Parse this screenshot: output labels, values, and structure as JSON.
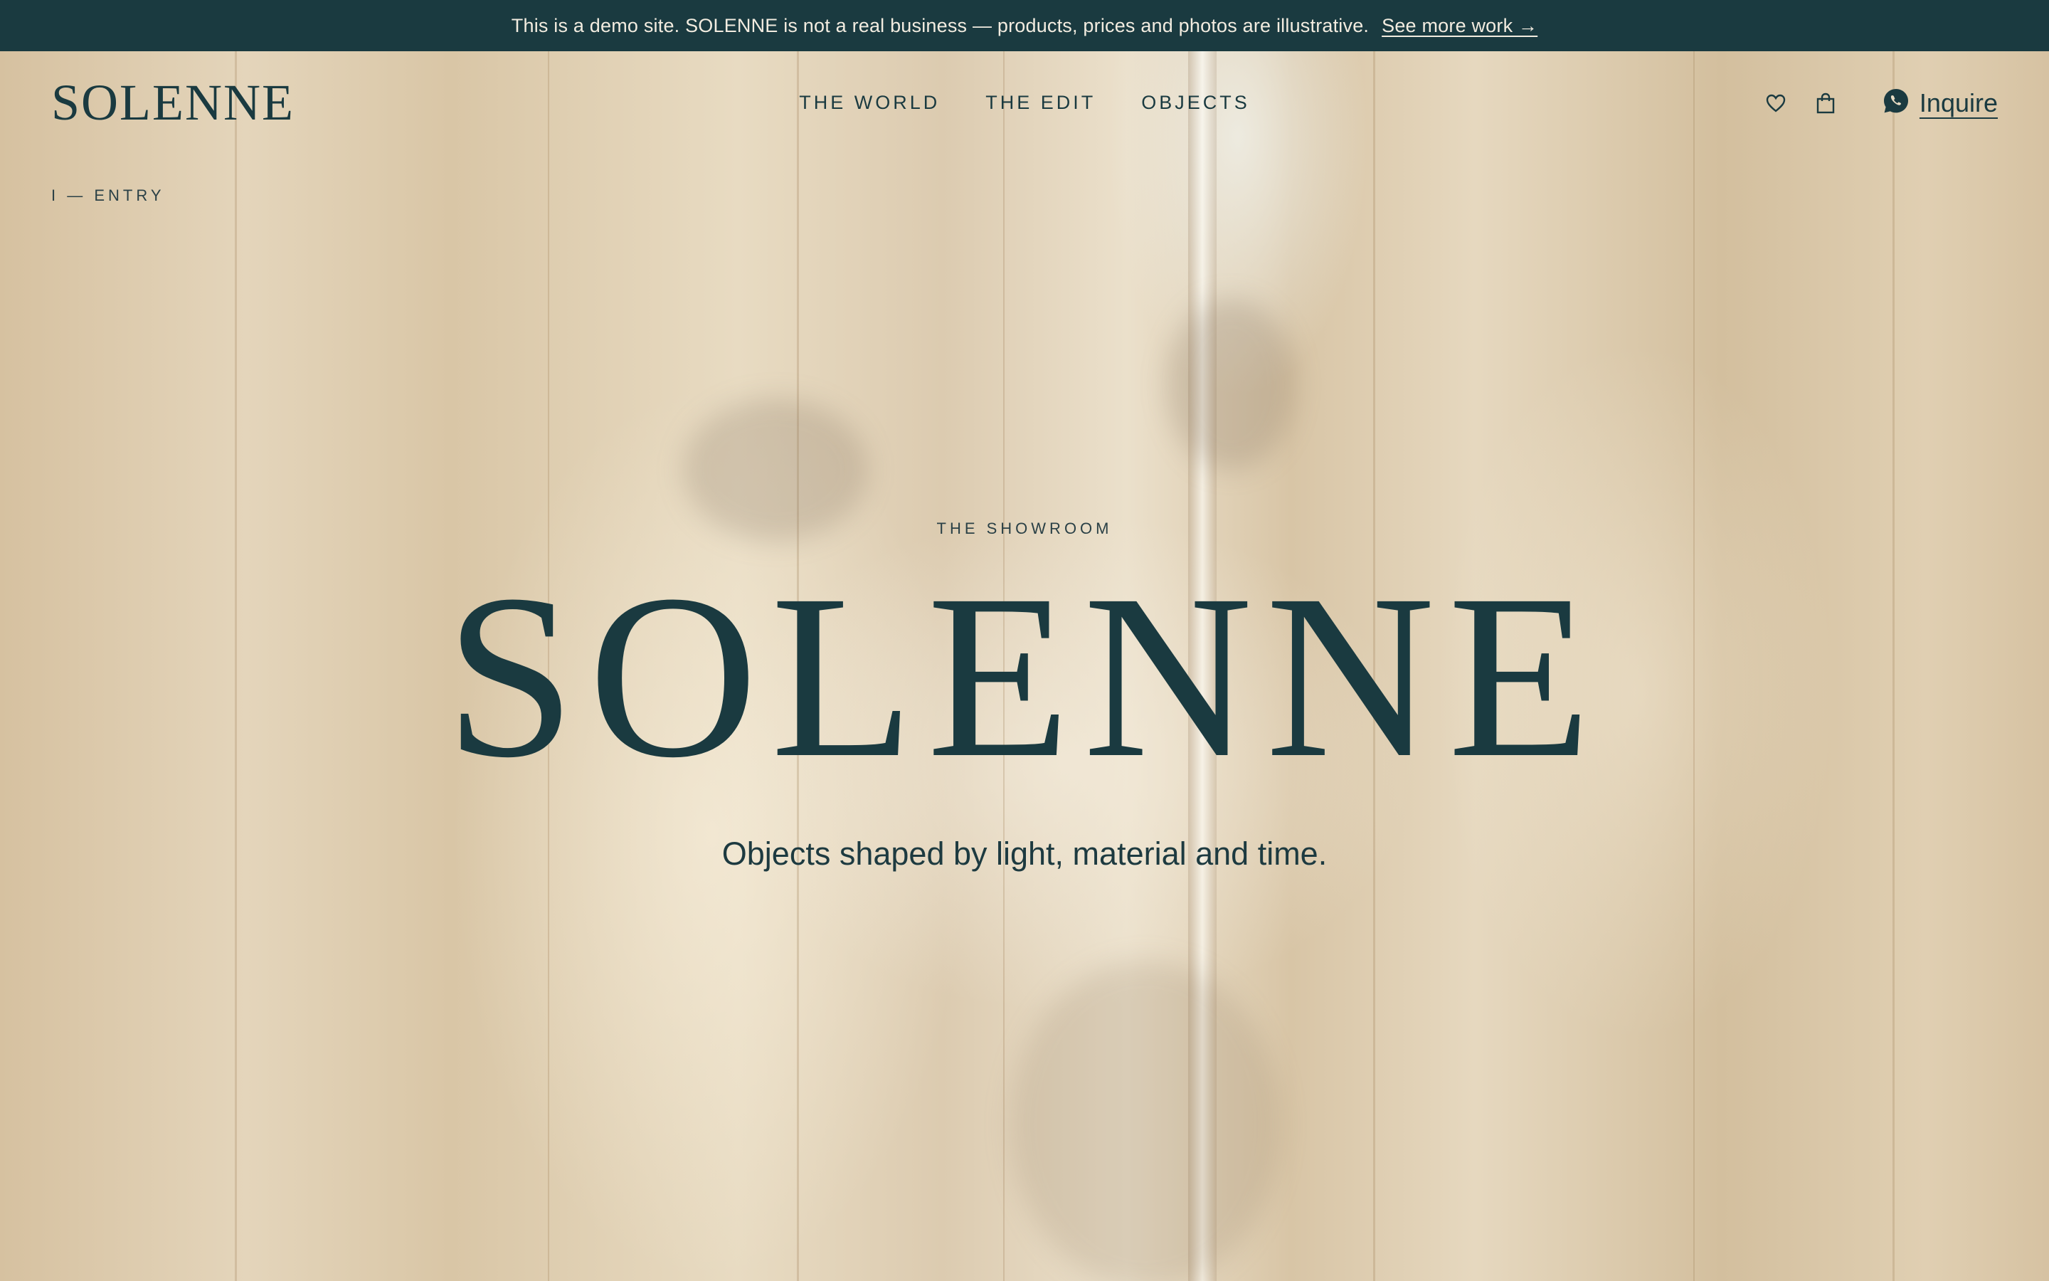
{
  "announcement": {
    "text": "This is a demo site. SOLENNE is not a real business — products, prices and photos are illustrative.",
    "link_label": "See more work →"
  },
  "header": {
    "logo": "SOLENNE",
    "nav": [
      {
        "label": "THE WORLD"
      },
      {
        "label": "THE EDIT"
      },
      {
        "label": "OBJECTS"
      }
    ],
    "icons": {
      "wishlist": "heart-icon",
      "bag": "shopping-bag-icon",
      "chat": "whatsapp-icon"
    },
    "inquire_label": "Inquire"
  },
  "section_tag": "I — ENTRY",
  "hero": {
    "eyebrow": "THE SHOWROOM",
    "title": "SOLENNE",
    "subtitle": "Objects shaped by light, material and time."
  },
  "colors": {
    "accent": "#1a3a40",
    "background": "#e8dcc4",
    "announce_text": "#f2ece0"
  }
}
